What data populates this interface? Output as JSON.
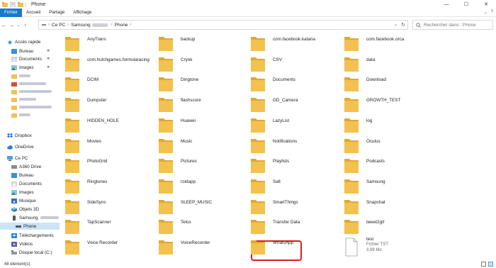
{
  "window": {
    "title": "Phone",
    "controls": {
      "minimize": "—",
      "maximize": "☐",
      "close": "✕"
    }
  },
  "ribbon": {
    "tabs": [
      "Fichier",
      "Accueil",
      "Partage",
      "Affichage"
    ],
    "right": {
      "expand": "⌄",
      "help": "?"
    }
  },
  "nav": {
    "back": "←",
    "forward": "→",
    "recent": "⌄",
    "up": "↑"
  },
  "address": {
    "root_glyph": "▬",
    "crumbs": [
      "Ce PC",
      "Samsung",
      "Phone"
    ],
    "dropdown": "⌄",
    "refresh": "↻"
  },
  "search": {
    "placeholder": "Rechercher dans : Phone",
    "icon": "search-icon"
  },
  "sidebar": {
    "quick_access": "Accès rapide",
    "pinned": [
      "Bureau",
      "Documents",
      "Images"
    ],
    "dropbox": "Dropbox",
    "onedrive": "OneDrive",
    "this_pc": "Ce PC",
    "pc_items": [
      "A360 Drive",
      "Bureau",
      "Documents",
      "Images",
      "Musique",
      "Objets 3D"
    ],
    "samsung": "Samsung",
    "phone": "Phone",
    "pc_items_after": [
      "Téléchargements",
      "Vidéos",
      "Disque local (C:)"
    ],
    "pin_glyph": "✱"
  },
  "folders": [
    "AnyTrans",
    "backup",
    "com.facebook.katana",
    "com.facebook.orca",
    "com.hutchgames.formularacing",
    "Cryok",
    "CSV",
    "data",
    "DCIM",
    "Dingtone",
    "Documents",
    "Download",
    "Dumpster",
    "flashscore",
    "GD_Camera",
    "GROWTH_TEST",
    "HIDDEN_HOLE",
    "Huawei",
    "LazyList",
    "log",
    "Movies",
    "Music",
    "Notifications",
    "Oculus",
    "PhotoGrid",
    "Pictures",
    "Playlists",
    "Podcasts",
    "Ringtones",
    "roidapp",
    "Salt",
    "Samsung",
    "SideSync",
    "SLEEP_MUSIC",
    "SmartThings",
    "Snapchat",
    "TapScanner",
    "Telos",
    "Transfer Data",
    "tweet2gif",
    "Voice Recorder",
    "VoiceRecorder",
    "WhatsApp"
  ],
  "file": {
    "name": "test",
    "type": "Fichier TST",
    "size": "3,99 Mo"
  },
  "status": {
    "count": "48 élément(s)"
  },
  "colors": {
    "accent": "#1979ca",
    "folder": "#f3c14d",
    "folder_back": "#dfa834",
    "highlight": "#e21b1b",
    "selected": "#cce4f7"
  }
}
